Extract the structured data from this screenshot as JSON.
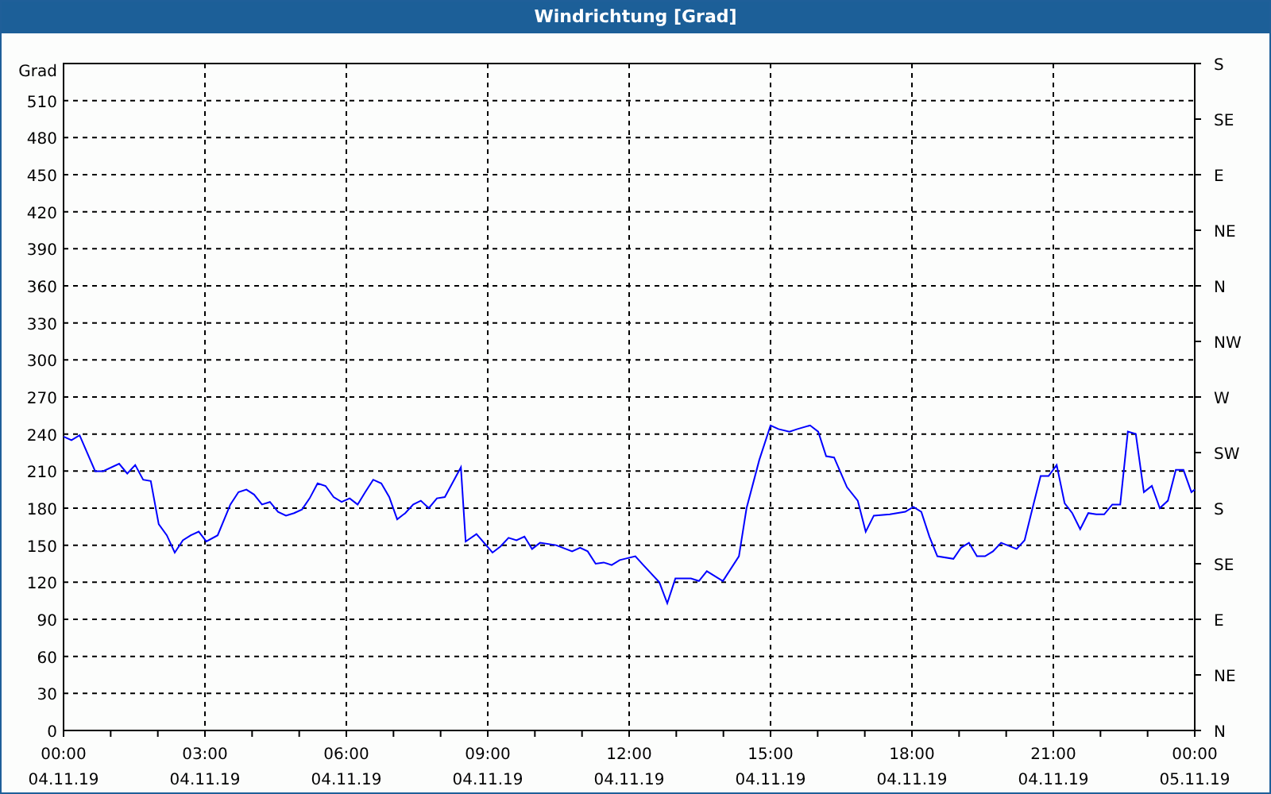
{
  "window": {
    "title": "Windrichtung [Grad]"
  },
  "chart": {
    "x_tick_dates": [
      "04.11.19",
      "04.11.19",
      "04.11.19",
      "04.11.19",
      "04.11.19",
      "04.11.19",
      "04.11.19",
      "04.11.19",
      "05.11.19"
    ],
    "compass_labels": [
      "S",
      "SE",
      "E",
      "NE",
      "N",
      "NW",
      "W",
      "SW",
      "S",
      "SE",
      "E",
      "NE",
      "N"
    ],
    "chart_data": {
      "type": "line",
      "grid": true,
      "ylabel": "Grad",
      "xlim": [
        0,
        24
      ],
      "ylim": [
        0,
        540
      ],
      "xticks": [
        {
          "value": 0,
          "label": "00:00"
        },
        {
          "value": 3,
          "label": "03:00"
        },
        {
          "value": 6,
          "label": "06:00"
        },
        {
          "value": 9,
          "label": "09:00"
        },
        {
          "value": 12,
          "label": "12:00"
        },
        {
          "value": 15,
          "label": "15:00"
        },
        {
          "value": 18,
          "label": "18:00"
        },
        {
          "value": 21,
          "label": "21:00"
        },
        {
          "value": 24,
          "label": "00:00"
        }
      ],
      "yticks": [
        0,
        30,
        60,
        90,
        120,
        150,
        180,
        210,
        240,
        270,
        300,
        330,
        360,
        390,
        420,
        450,
        480,
        510
      ],
      "x": [
        0,
        0.17,
        0.34,
        0.67,
        0.84,
        1.18,
        1.35,
        1.52,
        1.69,
        1.85,
        2.02,
        2.19,
        2.36,
        2.53,
        2.7,
        2.87,
        3.03,
        3.27,
        3.54,
        3.71,
        3.88,
        4.04,
        4.21,
        4.38,
        4.55,
        4.72,
        4.89,
        5.06,
        5.22,
        5.39,
        5.56,
        5.73,
        5.9,
        6.07,
        6.24,
        6.4,
        6.57,
        6.74,
        6.91,
        7.08,
        7.25,
        7.42,
        7.58,
        7.75,
        7.92,
        8.09,
        8.43,
        8.53,
        8.76,
        9.1,
        9.27,
        9.44,
        9.61,
        9.78,
        9.94,
        10.11,
        10.45,
        10.79,
        10.96,
        11.12,
        11.29,
        11.46,
        11.63,
        11.8,
        12.13,
        12.3,
        12.64,
        12.81,
        12.98,
        13.31,
        13.48,
        13.65,
        13.99,
        14.33,
        14.49,
        14.76,
        15,
        15.17,
        15.4,
        15.57,
        15.84,
        16.01,
        16.18,
        16.35,
        16.62,
        16.85,
        17.02,
        17.19,
        17.53,
        17.86,
        18.03,
        18.2,
        18.37,
        18.54,
        18.88,
        19.04,
        19.21,
        19.38,
        19.55,
        19.72,
        19.89,
        20.22,
        20.39,
        20.56,
        20.73,
        20.9,
        21.07,
        21.24,
        21.4,
        21.57,
        21.74,
        21.91,
        22.08,
        22.25,
        22.42,
        22.58,
        22.75,
        22.92,
        23.09,
        23.26,
        23.43,
        23.6,
        23.76,
        23.93,
        24
      ],
      "series": [
        {
          "color": "#0000ff",
          "values": [
            238,
            235,
            239,
            210,
            210,
            216,
            208,
            215,
            203,
            202,
            167,
            158,
            144,
            154,
            158,
            161,
            153,
            158,
            183,
            193,
            195,
            191,
            183,
            185,
            177,
            174,
            176,
            179,
            188,
            200,
            198,
            189,
            185,
            188,
            183,
            193,
            203,
            200,
            189,
            171,
            176,
            183,
            186,
            180,
            188,
            189,
            213,
            153,
            159,
            144,
            149,
            156,
            154,
            157,
            147,
            152,
            150,
            145,
            148,
            145,
            135,
            136,
            134,
            138,
            141,
            134,
            120,
            103,
            123,
            123,
            121,
            129,
            121,
            141,
            180,
            219,
            247,
            244,
            242,
            244,
            247,
            242,
            222,
            221,
            197,
            186,
            161,
            174,
            175,
            177,
            181,
            177,
            157,
            141,
            139,
            148,
            152,
            141,
            141,
            145,
            152,
            147,
            154,
            180,
            206,
            206,
            215,
            184,
            176,
            163,
            176,
            175,
            175,
            183,
            183,
            242,
            240,
            193,
            198,
            180,
            186,
            211,
            211,
            193,
            195
          ]
        }
      ]
    }
  }
}
